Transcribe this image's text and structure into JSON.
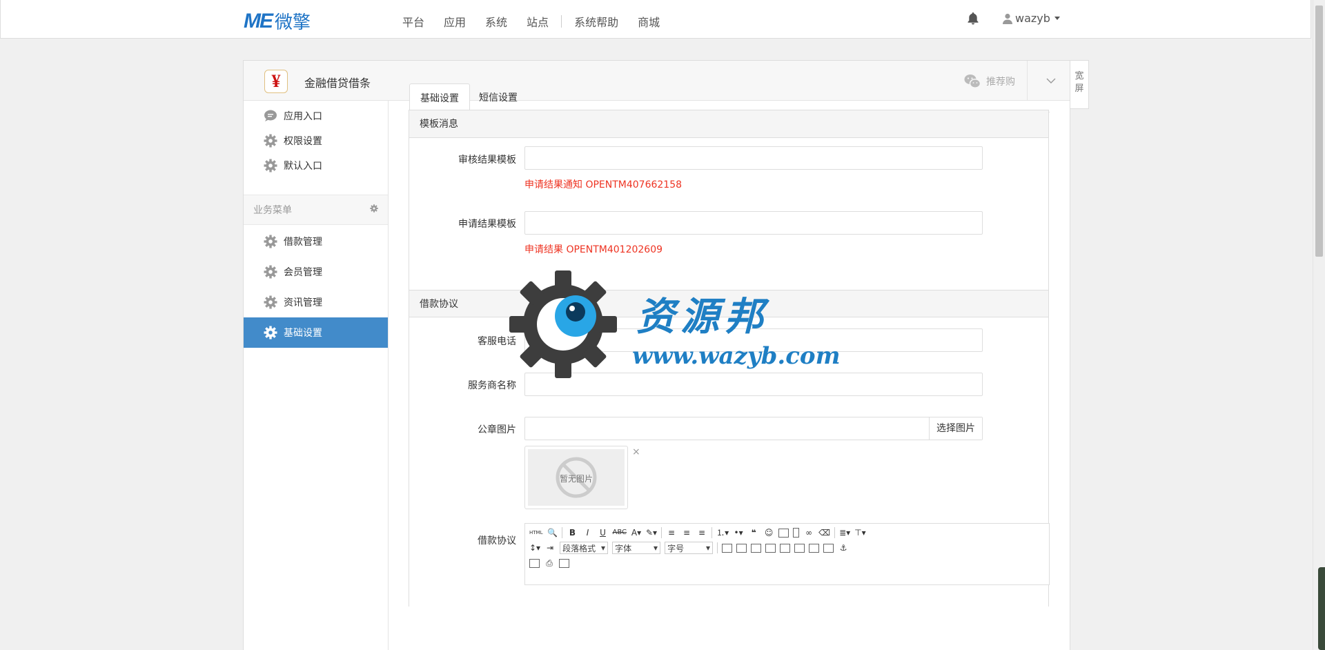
{
  "topbar": {
    "logo_latin": "ME",
    "logo_cn": "微擎",
    "nav": [
      "平台",
      "应用",
      "系统",
      "站点",
      "系统帮助",
      "商城"
    ],
    "notification_icon": "bell-icon",
    "username": "wazyb"
  },
  "module": {
    "icon_char": "¥",
    "title": "金融借贷借条",
    "recommend": "推荐购",
    "wide_screen": "宽屏"
  },
  "sidebar": {
    "top_items": [
      {
        "label": "应用入口",
        "icon": "chat-bubble-icon"
      },
      {
        "label": "权限设置",
        "icon": "gear-icon"
      },
      {
        "label": "默认入口",
        "icon": "gear-icon"
      }
    ],
    "group_label": "业务菜单",
    "menu_items": [
      {
        "label": "借款管理",
        "icon": "gear-icon"
      },
      {
        "label": "会员管理",
        "icon": "gear-icon"
      },
      {
        "label": "资讯管理",
        "icon": "gear-icon"
      },
      {
        "label": "基础设置",
        "icon": "gear-icon",
        "active": true
      }
    ]
  },
  "tabs": [
    "基础设置",
    "短信设置"
  ],
  "panel_template": {
    "heading": "模板消息",
    "fields": [
      {
        "label": "审核结果模板",
        "value": "",
        "hint": "申请结果通知 OPENTM407662158"
      },
      {
        "label": "申请结果模板",
        "value": "",
        "hint": "申请结果 OPENTM401202609"
      }
    ]
  },
  "panel_agreement": {
    "heading": "借款协议",
    "phone_label": "客服电话",
    "phone_value": "",
    "provider_label": "服务商名称",
    "provider_value": "",
    "seal_label": "公章图片",
    "seal_value": "",
    "pick_image": "选择图片",
    "no_image": "暂无图片",
    "remove": "×",
    "agreement_label": "借款协议",
    "editor": {
      "html_btn": "HTML",
      "paragraph": "段落格式",
      "font": "字体",
      "size": "字号"
    }
  },
  "watermark": {
    "title": "资源邦",
    "url": "www.wazyb.com"
  },
  "colors": {
    "brand": "#1f74c6",
    "active_menu": "#428bca",
    "hint": "#e32"
  }
}
